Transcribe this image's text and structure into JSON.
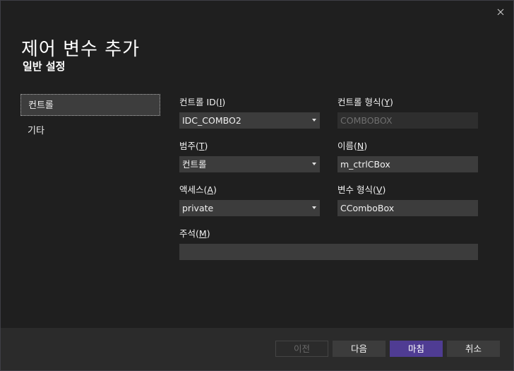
{
  "header": {
    "title": "제어 변수 추가",
    "subtitle": "일반 설정"
  },
  "nav": {
    "items": [
      {
        "label": "컨트롤",
        "selected": true
      },
      {
        "label": "기타",
        "selected": false
      }
    ]
  },
  "fields": {
    "control_id": {
      "label": "컨트롤 ID",
      "mnemonic": "I",
      "value": "IDC_COMBO2"
    },
    "control_type": {
      "label": "컨트롤 형식",
      "mnemonic": "Y",
      "value": "COMBOBOX"
    },
    "category": {
      "label": "범주",
      "mnemonic": "T",
      "value": "컨트롤"
    },
    "name": {
      "label": "이름",
      "mnemonic": "N",
      "value": "m_ctrlCBox"
    },
    "access": {
      "label": "액세스",
      "mnemonic": "A",
      "value": "private"
    },
    "var_type": {
      "label": "변수 형식",
      "mnemonic": "V",
      "value": "CComboBox"
    },
    "comment": {
      "label": "주석",
      "mnemonic": "M",
      "value": ""
    }
  },
  "footer": {
    "prev_label": "이전",
    "next_label": "다음",
    "finish_label": "마침",
    "cancel_label": "취소"
  },
  "colors": {
    "background": "#1f1f1f",
    "input": "#3c3c3c",
    "primary_button": "#4f3c93",
    "footer": "#2b2b2b"
  },
  "icons": {
    "close": "close-icon",
    "dropdown": "chevron-down-icon"
  }
}
